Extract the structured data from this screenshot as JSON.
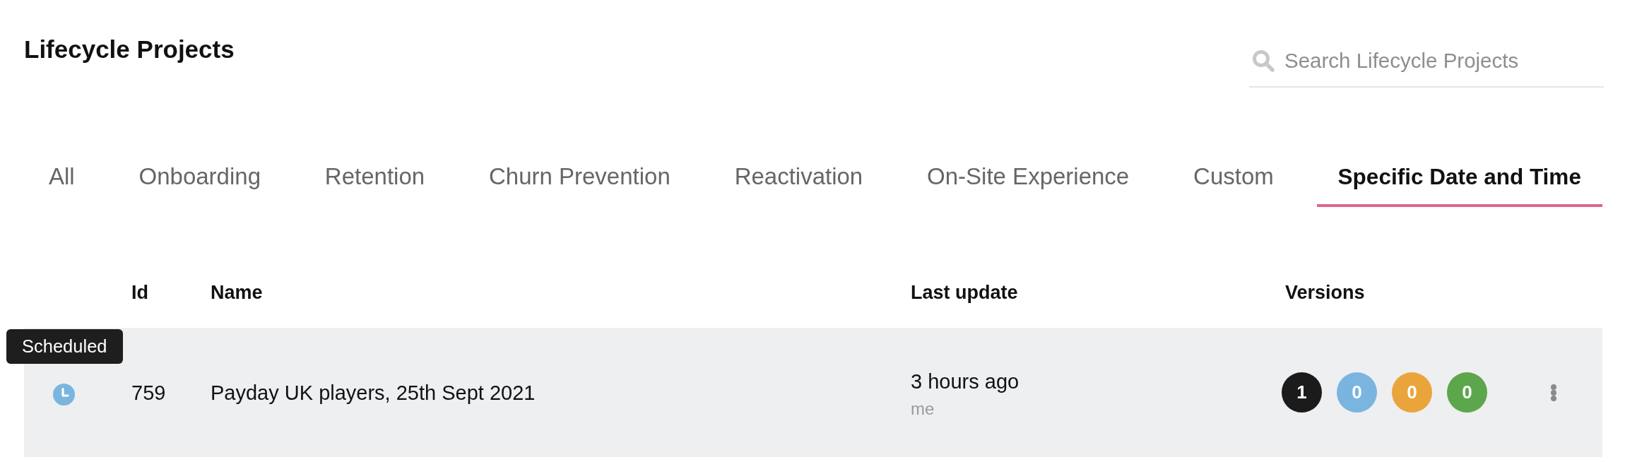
{
  "page": {
    "title": "Lifecycle Projects"
  },
  "search": {
    "placeholder": "Search Lifecycle Projects"
  },
  "tabs": [
    {
      "label": "All",
      "selected": false
    },
    {
      "label": "Onboarding",
      "selected": false
    },
    {
      "label": "Retention",
      "selected": false
    },
    {
      "label": "Churn Prevention",
      "selected": false
    },
    {
      "label": "Reactivation",
      "selected": false
    },
    {
      "label": "On-Site Experience",
      "selected": false
    },
    {
      "label": "Custom",
      "selected": false
    },
    {
      "label": "Specific Date and Time",
      "selected": true
    }
  ],
  "table": {
    "columns": [
      "Id",
      "Name",
      "Last update",
      "Versions"
    ],
    "rows": [
      {
        "status": {
          "kind": "scheduled",
          "tooltip": "Scheduled"
        },
        "id": "759",
        "name": "Payday UK players, 25th Sept 2021",
        "last_update": "3 hours ago",
        "updated_by": "me",
        "versions": [
          {
            "count": "1",
            "color": "#1b1b1b"
          },
          {
            "count": "0",
            "color": "#7ab5e0"
          },
          {
            "count": "0",
            "color": "#e9a53c"
          },
          {
            "count": "0",
            "color": "#5ca64b"
          }
        ]
      }
    ]
  }
}
